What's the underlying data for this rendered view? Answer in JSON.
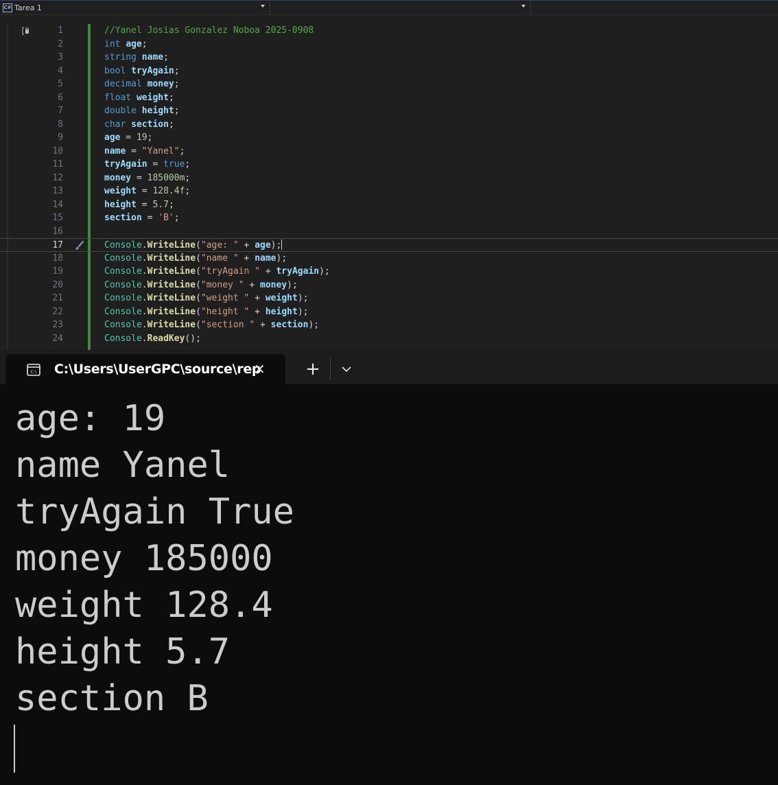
{
  "editor": {
    "project_label": "Tarea 1",
    "project_icon": "C#",
    "current_line": 17,
    "lines": [
      [
        {
          "t": "//Yanel Josias Gonzalez Noboa 2025-0908",
          "c": "comment"
        }
      ],
      [
        {
          "t": "int",
          "c": "kw"
        },
        {
          "t": " ",
          "c": "punc"
        },
        {
          "t": "age",
          "c": "var"
        },
        {
          "t": ";",
          "c": "punc"
        }
      ],
      [
        {
          "t": "string",
          "c": "kw"
        },
        {
          "t": " ",
          "c": "punc"
        },
        {
          "t": "name",
          "c": "var"
        },
        {
          "t": ";",
          "c": "punc"
        }
      ],
      [
        {
          "t": "bool",
          "c": "kw"
        },
        {
          "t": " ",
          "c": "punc"
        },
        {
          "t": "tryAgain",
          "c": "var"
        },
        {
          "t": ";",
          "c": "punc"
        }
      ],
      [
        {
          "t": "decimal",
          "c": "kw"
        },
        {
          "t": " ",
          "c": "punc"
        },
        {
          "t": "money",
          "c": "var"
        },
        {
          "t": ";",
          "c": "punc"
        }
      ],
      [
        {
          "t": "float",
          "c": "kw"
        },
        {
          "t": " ",
          "c": "punc"
        },
        {
          "t": "weight",
          "c": "var"
        },
        {
          "t": ";",
          "c": "punc"
        }
      ],
      [
        {
          "t": "double",
          "c": "kw"
        },
        {
          "t": " ",
          "c": "punc"
        },
        {
          "t": "height",
          "c": "var"
        },
        {
          "t": ";",
          "c": "punc"
        }
      ],
      [
        {
          "t": "char",
          "c": "kw"
        },
        {
          "t": " ",
          "c": "punc"
        },
        {
          "t": "section",
          "c": "var"
        },
        {
          "t": ";",
          "c": "punc"
        }
      ],
      [
        {
          "t": "age",
          "c": "var"
        },
        {
          "t": " = ",
          "c": "punc"
        },
        {
          "t": "19",
          "c": "num"
        },
        {
          "t": ";",
          "c": "punc"
        }
      ],
      [
        {
          "t": "name",
          "c": "var"
        },
        {
          "t": " = ",
          "c": "punc"
        },
        {
          "t": "\"Yanel\"",
          "c": "str"
        },
        {
          "t": ";",
          "c": "punc"
        }
      ],
      [
        {
          "t": "tryAgain",
          "c": "var"
        },
        {
          "t": " = ",
          "c": "punc"
        },
        {
          "t": "true",
          "c": "kw"
        },
        {
          "t": ";",
          "c": "punc"
        }
      ],
      [
        {
          "t": "money",
          "c": "var"
        },
        {
          "t": " = ",
          "c": "punc"
        },
        {
          "t": "185000m",
          "c": "num"
        },
        {
          "t": ";",
          "c": "punc"
        }
      ],
      [
        {
          "t": "weight",
          "c": "var"
        },
        {
          "t": " = ",
          "c": "punc"
        },
        {
          "t": "128.4f",
          "c": "num"
        },
        {
          "t": ";",
          "c": "punc"
        }
      ],
      [
        {
          "t": "height",
          "c": "var"
        },
        {
          "t": " = ",
          "c": "punc"
        },
        {
          "t": "5.7",
          "c": "num"
        },
        {
          "t": ";",
          "c": "punc"
        }
      ],
      [
        {
          "t": "section",
          "c": "var"
        },
        {
          "t": " = ",
          "c": "punc"
        },
        {
          "t": "'B'",
          "c": "str"
        },
        {
          "t": ";",
          "c": "punc"
        }
      ],
      [],
      [
        {
          "t": "Console",
          "c": "cls"
        },
        {
          "t": ".",
          "c": "punc"
        },
        {
          "t": "WriteLine",
          "c": "meth"
        },
        {
          "t": "(",
          "c": "punc"
        },
        {
          "t": "\"age: \"",
          "c": "str"
        },
        {
          "t": " + ",
          "c": "punc"
        },
        {
          "t": "age",
          "c": "var"
        },
        {
          "t": ");",
          "c": "punc"
        }
      ],
      [
        {
          "t": "Console",
          "c": "cls"
        },
        {
          "t": ".",
          "c": "punc"
        },
        {
          "t": "WriteLine",
          "c": "meth"
        },
        {
          "t": "(",
          "c": "punc"
        },
        {
          "t": "\"name \"",
          "c": "str"
        },
        {
          "t": " + ",
          "c": "punc"
        },
        {
          "t": "name",
          "c": "var"
        },
        {
          "t": ");",
          "c": "punc"
        }
      ],
      [
        {
          "t": "Console",
          "c": "cls"
        },
        {
          "t": ".",
          "c": "punc"
        },
        {
          "t": "WriteLine",
          "c": "meth"
        },
        {
          "t": "(",
          "c": "punc"
        },
        {
          "t": "\"tryAgain \"",
          "c": "str"
        },
        {
          "t": " + ",
          "c": "punc"
        },
        {
          "t": "tryAgain",
          "c": "var"
        },
        {
          "t": ");",
          "c": "punc"
        }
      ],
      [
        {
          "t": "Console",
          "c": "cls"
        },
        {
          "t": ".",
          "c": "punc"
        },
        {
          "t": "WriteLine",
          "c": "meth"
        },
        {
          "t": "(",
          "c": "punc"
        },
        {
          "t": "\"money \"",
          "c": "str"
        },
        {
          "t": " + ",
          "c": "punc"
        },
        {
          "t": "money",
          "c": "var"
        },
        {
          "t": ");",
          "c": "punc"
        }
      ],
      [
        {
          "t": "Console",
          "c": "cls"
        },
        {
          "t": ".",
          "c": "punc"
        },
        {
          "t": "WriteLine",
          "c": "meth"
        },
        {
          "t": "(",
          "c": "punc"
        },
        {
          "t": "\"weight \"",
          "c": "str"
        },
        {
          "t": " + ",
          "c": "punc"
        },
        {
          "t": "weight",
          "c": "var"
        },
        {
          "t": ");",
          "c": "punc"
        }
      ],
      [
        {
          "t": "Console",
          "c": "cls"
        },
        {
          "t": ".",
          "c": "punc"
        },
        {
          "t": "WriteLine",
          "c": "meth"
        },
        {
          "t": "(",
          "c": "punc"
        },
        {
          "t": "\"height \"",
          "c": "str"
        },
        {
          "t": " + ",
          "c": "punc"
        },
        {
          "t": "height",
          "c": "var"
        },
        {
          "t": ");",
          "c": "punc"
        }
      ],
      [
        {
          "t": "Console",
          "c": "cls"
        },
        {
          "t": ".",
          "c": "punc"
        },
        {
          "t": "WriteLine",
          "c": "meth"
        },
        {
          "t": "(",
          "c": "punc"
        },
        {
          "t": "\"section \"",
          "c": "str"
        },
        {
          "t": " + ",
          "c": "punc"
        },
        {
          "t": "section",
          "c": "var"
        },
        {
          "t": ");",
          "c": "punc"
        }
      ],
      [
        {
          "t": "Console",
          "c": "cls"
        },
        {
          "t": ".",
          "c": "punc"
        },
        {
          "t": "ReadKey",
          "c": "meth"
        },
        {
          "t": "();",
          "c": "punc"
        }
      ]
    ]
  },
  "terminal": {
    "tab_title": "C:\\Users\\UserGPC\\source\\rep",
    "close_glyph": "✕",
    "new_tab_glyph": "+",
    "output": [
      "age: 19",
      "name Yanel",
      "tryAgain True",
      "money 185000",
      "weight 128.4",
      "height 5.7",
      "section B"
    ]
  },
  "colors": {
    "editor_bg": "#1f1f1f",
    "terminal_bg": "#0c0c0c",
    "keyword": "#569cd6",
    "variable": "#9cdcfe",
    "string": "#d69d85",
    "number": "#b5cea8",
    "class": "#4ec9b0",
    "method": "#dcdcaa",
    "comment": "#57a64a",
    "change_bar": "#3c8d3c"
  },
  "icons": {
    "project": "csharp-file-icon",
    "quick_action": "paintbrush-icon",
    "tab": "console-icon",
    "dropdown": "chevron-down-icon"
  }
}
